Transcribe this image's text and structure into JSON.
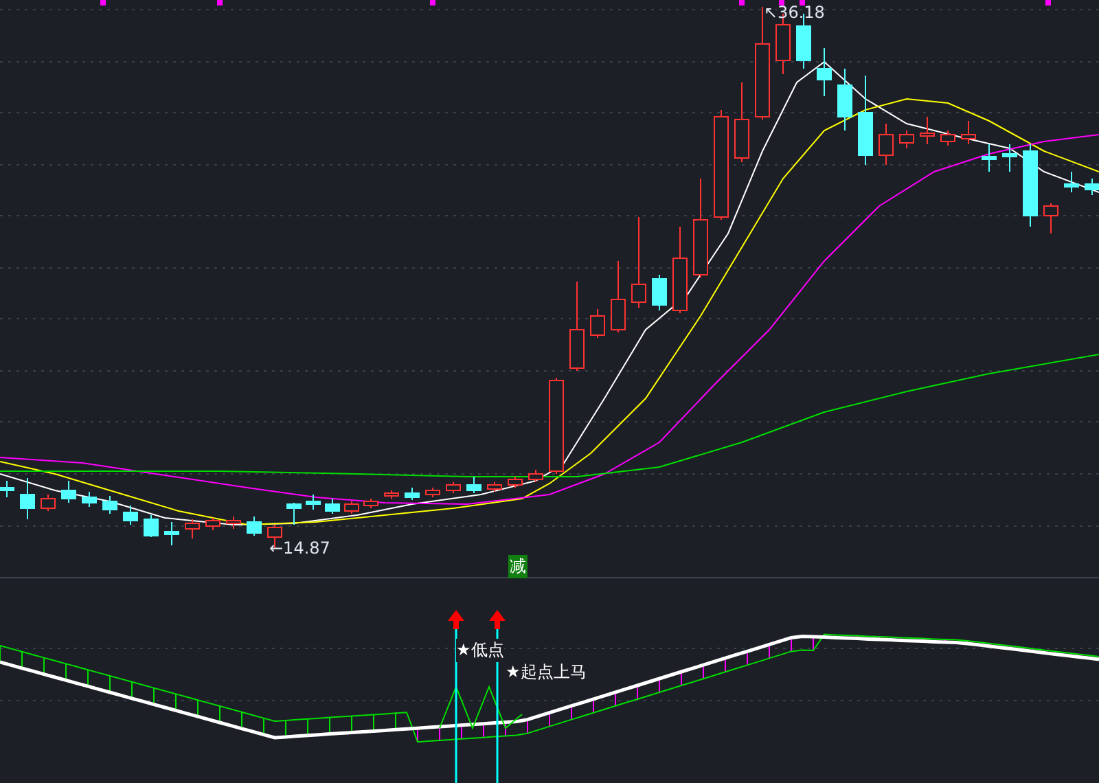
{
  "price_chart": {
    "high_label": "↖36.18",
    "low_label": "←14.87"
  },
  "signal_badge": "减",
  "indicator": {
    "signals": [
      {
        "label": "★低点"
      },
      {
        "label": "★起点上马"
      }
    ]
  }
}
